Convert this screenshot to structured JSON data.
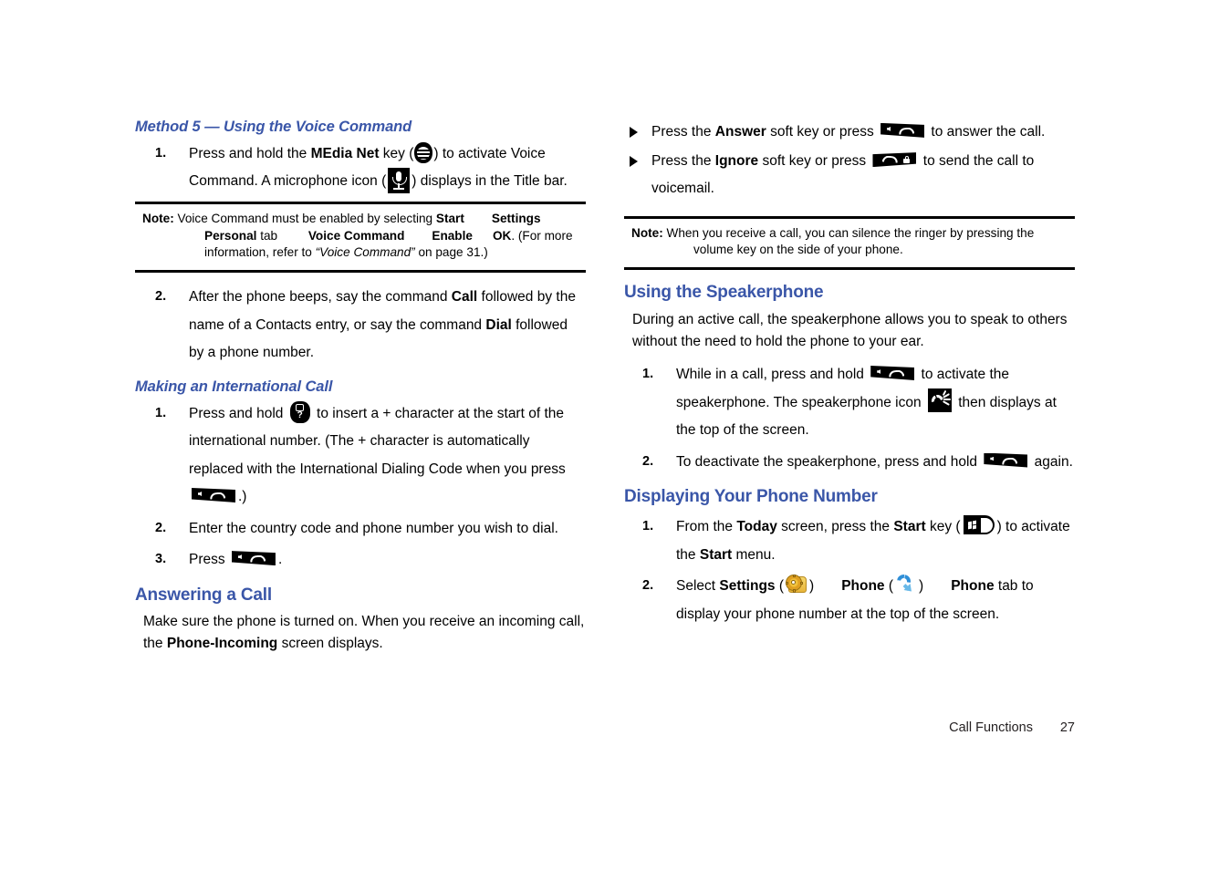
{
  "document": {
    "page_number": "27",
    "footer_section": "Call Functions",
    "heading_color": "#3a56a8"
  },
  "left_column": {
    "subheading_1": "Method 5 — Using the Voice Command",
    "step_1": {
      "num": "1.",
      "p1": "Press and hold the ",
      "b1": "MEdia Net",
      "p2": " key (",
      "p3": ") to activate Voice Command. A microphone icon (",
      "p4": ") displays in the Title bar."
    },
    "note_1": {
      "label": "Note:",
      "t1": " Voice Command must be enabled by selecting ",
      "b1": "Start",
      "b2": "Settings",
      "b3": "Personal",
      "t2": " tab ",
      "b4": "Voice Command",
      "b5": "Enable",
      "b6": "OK",
      "t3": ". (For more",
      "t4": "information, refer to ",
      "i1": "“Voice Command”",
      "t5": " on page 31.)"
    },
    "step_2": {
      "num": "2.",
      "p1": "After the phone beeps, say the command ",
      "b1": "Call",
      "p2": " followed by the name of a Contacts entry, or say the command ",
      "b2": "Dial",
      "p3": " followed by a phone number."
    },
    "subheading_2": "Making an International Call",
    "intl_step_1": {
      "num": "1.",
      "p1": "Press and hold ",
      "p2": " to insert a + character at the start of the international number. (The + character is automatically replaced with the International Dialing Code when you press ",
      "p3": ".)"
    },
    "intl_step_2": {
      "num": "2.",
      "p1": "Enter the country code and phone number you wish to dial."
    },
    "intl_step_3": {
      "num": "3.",
      "p1": "Press ",
      "p2": "."
    },
    "heading_answering": "Answering a Call",
    "answering_para": {
      "t1": "Make sure the phone is turned on. When you receive an incoming call, the ",
      "b1": "Phone-Incoming",
      "t2": " screen displays."
    }
  },
  "right_column": {
    "bullet_answer": {
      "p1": "Press the ",
      "b1": "Answer",
      "p2": " soft key or press ",
      "p3": " to answer the call."
    },
    "bullet_ignore": {
      "p1": "Press the ",
      "b1": "Ignore",
      "p2": " soft key or press ",
      "p3": " to send the call to voicemail."
    },
    "note_2": {
      "label": "Note:",
      "t1": " When you receive a call, you can silence the ringer by pressing the",
      "t2": "volume key on the side of your phone."
    },
    "heading_speakerphone": "Using the Speakerphone",
    "speakerphone_para": "During an active call, the speakerphone allows you to speak to others without the need to hold the phone to your ear.",
    "spk_step_1": {
      "num": "1.",
      "p1": "While in a call, press and hold ",
      "p2": " to activate the speakerphone. The speakerphone icon ",
      "p3": " then displays at the top of the screen."
    },
    "spk_step_2": {
      "num": "2.",
      "p1": "To deactivate the speakerphone, press and hold ",
      "p2": " again."
    },
    "heading_display_number": "Displaying Your Phone Number",
    "dn_step_1": {
      "num": "1.",
      "p1": "From the ",
      "b1": "Today",
      "p2": " screen, press the ",
      "b2": "Start",
      "p3": " key (",
      "p4": ") to activate the ",
      "b3": "Start",
      "p5": " menu."
    },
    "dn_step_2": {
      "num": "2.",
      "p1": "Select ",
      "b1": "Settings",
      "p2": " (",
      "p3": ")",
      "b2": "Phone",
      "p4": " (",
      "p5": ")",
      "b3": "Phone",
      "p6": " tab to display your phone number at the top of the screen."
    }
  },
  "icons": {
    "media_net_key": "att-globe-key-icon",
    "microphone": "microphone-icon",
    "zero_plus_key": "zero-plus-key-icon",
    "send_key": "send-call-key-icon",
    "end_key": "end-call-key-icon",
    "speakerphone": "speakerphone-icon",
    "start_key": "windows-start-key-icon",
    "settings": "settings-gear-folder-icon",
    "phone": "phone-handset-icon"
  }
}
